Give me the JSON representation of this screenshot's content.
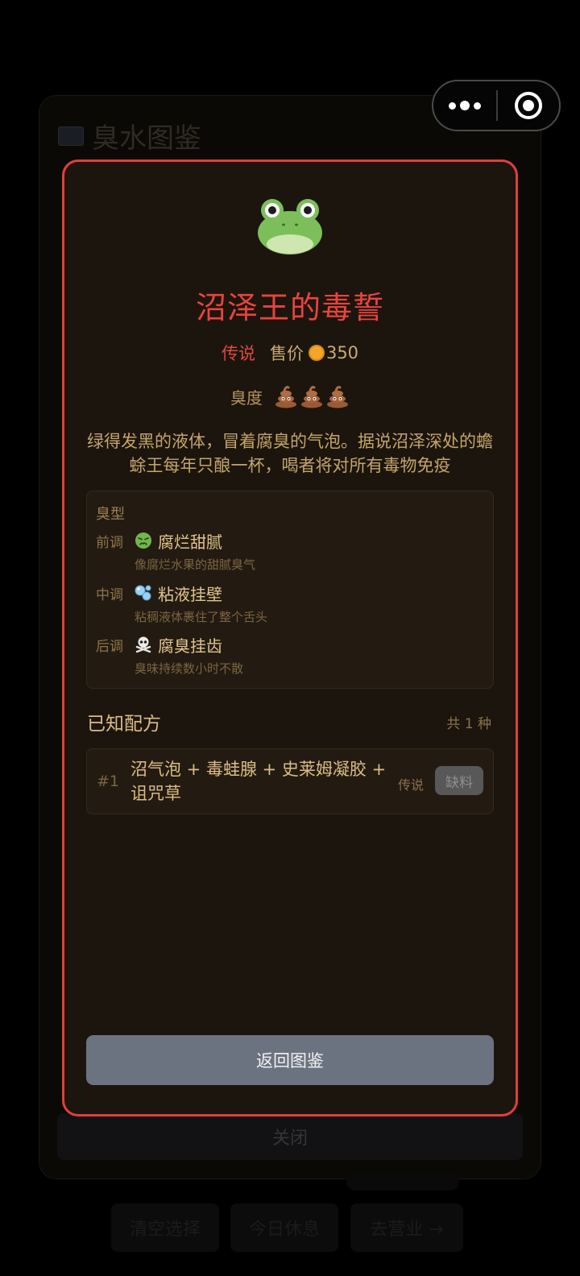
{
  "background": {
    "title": "臭水图鉴",
    "close_label": "关闭",
    "bottom_buttons": [
      "清空选择",
      "今日休息",
      "去营业 →"
    ]
  },
  "capsule": {
    "more_icon": "more-dots-icon",
    "close_icon": "target-circle-icon"
  },
  "modal": {
    "potion_icon": "frog-icon",
    "name": "沼泽王的毒誓",
    "rarity": "传说",
    "price_label": "售价",
    "price_icon": "coin-icon",
    "price": "350",
    "smell_label": "臭度",
    "smell_level": 3,
    "smell_icon": "poop-icon",
    "description": "绿得发黑的液体，冒着腐臭的气泡。据说沼泽深处的蟾蜍王每年只酿一杯，喝者将对所有毒物免疫",
    "smell_profile": {
      "title": "臭型",
      "notes": [
        {
          "label": "前调",
          "icon": "nauseated-face-icon",
          "name": "腐烂甜腻",
          "sub": "像腐烂水果的甜腻臭气"
        },
        {
          "label": "中调",
          "icon": "bubbles-icon",
          "name": "粘液挂壁",
          "sub": "粘稠液体裹住了整个舌头"
        },
        {
          "label": "后调",
          "icon": "skull-crossbones-icon",
          "name": "腐臭挂齿",
          "sub": "臭味持续数小时不散"
        }
      ]
    },
    "recipes": {
      "title": "已知配方",
      "count": "共 1 种",
      "items": [
        {
          "index": "#1",
          "ingredients": "沼气泡 + 毒蛙腺 + 史莱姆凝胶 + 诅咒草",
          "rarity": "传说",
          "status": "缺料"
        }
      ]
    },
    "back_label": "返回图鉴"
  },
  "colors": {
    "modal_border": "#e23e3e",
    "modal_bg": "#1c150e",
    "title_red": "#e8443c",
    "gold_text": "#c9a86a",
    "back_button": "#6b7380"
  }
}
